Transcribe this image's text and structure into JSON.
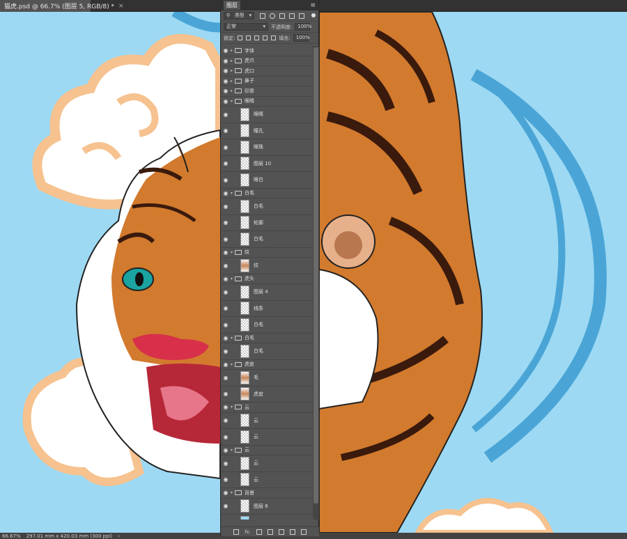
{
  "document": {
    "tab_title": "猫虎.psd @ 66.7% (图层 5, RGB/8) *",
    "close_glyph": "×"
  },
  "status": {
    "zoom": "66.67%",
    "dimensions": "297.01 mm x 420.03 mm (300 ppi)",
    "arrow": "›"
  },
  "panel": {
    "tab_label": "图层",
    "menu_glyph": "≡",
    "filter_label": "类型",
    "blend_mode": "正常",
    "opacity_label": "不透明度:",
    "opacity_value": "100%",
    "lock_label": "锁定:",
    "fill_label": "填充:",
    "fill_value": "100%",
    "footer_fx": "fx."
  },
  "layers": [
    {
      "name": "字体",
      "kind": "group",
      "collapsed": true
    },
    {
      "name": "虎爪",
      "kind": "group",
      "collapsed": true
    },
    {
      "name": "虎口",
      "kind": "group",
      "collapsed": true
    },
    {
      "name": "鼻子",
      "kind": "group",
      "collapsed": true
    },
    {
      "name": "印章",
      "kind": "group",
      "collapsed": true
    },
    {
      "name": "眼睛",
      "kind": "group",
      "collapsed": false
    },
    {
      "name": "眼睛",
      "kind": "pixel"
    },
    {
      "name": "瞳孔",
      "kind": "pixel"
    },
    {
      "name": "眼珠",
      "kind": "pixel"
    },
    {
      "name": "图层 10",
      "kind": "pixel"
    },
    {
      "name": "眼白",
      "kind": "pixel"
    },
    {
      "name": "白毛",
      "kind": "group",
      "collapsed": false
    },
    {
      "name": "白毛",
      "kind": "pixel"
    },
    {
      "name": "轮廓",
      "kind": "pixel"
    },
    {
      "name": "白毛",
      "kind": "pixel"
    },
    {
      "name": "纹",
      "kind": "group",
      "collapsed": false
    },
    {
      "name": "纹",
      "kind": "pixel",
      "thumb": "painted"
    },
    {
      "name": "虎头",
      "kind": "group",
      "collapsed": false
    },
    {
      "name": "图层 4",
      "kind": "pixel"
    },
    {
      "name": "线条",
      "kind": "pixel"
    },
    {
      "name": "白毛",
      "kind": "pixel"
    },
    {
      "name": "白毛",
      "kind": "group",
      "collapsed": false
    },
    {
      "name": "白毛",
      "kind": "pixel"
    },
    {
      "name": "虎皮",
      "kind": "group",
      "collapsed": false
    },
    {
      "name": "毛",
      "kind": "pixel",
      "thumb": "painted"
    },
    {
      "name": "虎皮",
      "kind": "pixel",
      "thumb": "painted"
    },
    {
      "name": "云",
      "kind": "group",
      "collapsed": false
    },
    {
      "name": "云",
      "kind": "pixel"
    },
    {
      "name": "云",
      "kind": "pixel"
    },
    {
      "name": "云",
      "kind": "group",
      "collapsed": false
    },
    {
      "name": "云",
      "kind": "pixel"
    },
    {
      "name": "云",
      "kind": "pixel"
    },
    {
      "name": "背景",
      "kind": "group",
      "collapsed": false
    },
    {
      "name": "图层 6",
      "kind": "pixel"
    },
    {
      "name": "",
      "kind": "pixel",
      "thumb": "sky"
    }
  ],
  "colors": {
    "sky": "#9dd9f3",
    "cloud_outline": "#f6c28f",
    "tiger_orange": "#d27a2e",
    "stripe": "#3a1a0c",
    "wind": "#4aa5d6"
  },
  "icons": {
    "eye": "eye-icon",
    "folder": "folder-icon",
    "search": "search-icon"
  }
}
